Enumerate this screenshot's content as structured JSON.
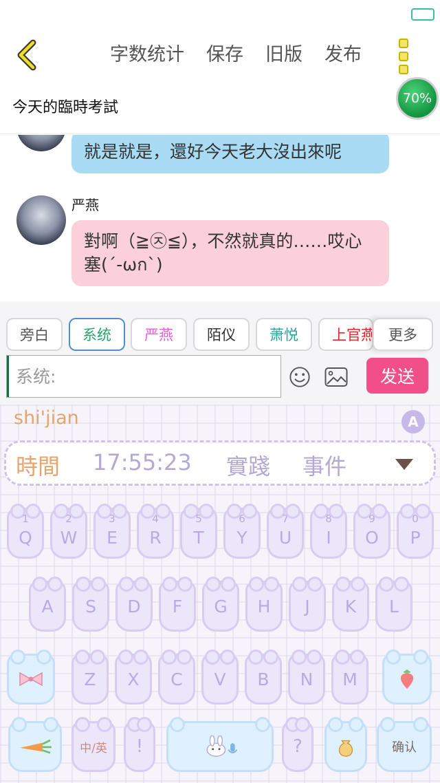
{
  "header": {
    "toolbar": [
      "字数统计",
      "保存",
      "旧版",
      "发布"
    ],
    "progress": "70%",
    "title": "今天的臨時考試"
  },
  "chat": {
    "messages": [
      {
        "text": "就是就是，還好今天老大沒出來呢"
      },
      {
        "sender": "严燕",
        "text": "對啊（≧㉨≦），不然就真的……哎心塞(´-ωก`)"
      }
    ]
  },
  "roles": [
    {
      "label": "旁白",
      "color": "#555555"
    },
    {
      "label": "系统",
      "color": "#25a56a",
      "active": true
    },
    {
      "label": "严燕",
      "color": "#e45fd6"
    },
    {
      "label": "陌仪",
      "color": "#333333"
    },
    {
      "label": "萧悦",
      "color": "#2aa49a"
    },
    {
      "label": "上官燕",
      "color": "#e1262d"
    }
  ],
  "more_label": "更多",
  "composer": {
    "placeholder": "系统:",
    "send_label": "发送"
  },
  "keyboard": {
    "pinyin": "shi'jian",
    "candidates": [
      "時間",
      "17:55:23",
      "實踐",
      "事件"
    ],
    "row1": [
      [
        "Q",
        "1"
      ],
      [
        "W",
        "2"
      ],
      [
        "E",
        "3"
      ],
      [
        "R",
        "4"
      ],
      [
        "T",
        "5"
      ],
      [
        "Y",
        "6"
      ],
      [
        "U",
        "7"
      ],
      [
        "I",
        "8"
      ],
      [
        "O",
        "9"
      ],
      [
        "P",
        "0"
      ]
    ],
    "row2": [
      "A",
      "S",
      "D",
      "F",
      "G",
      "H",
      "J",
      "K",
      "L"
    ],
    "row3": [
      "Z",
      "X",
      "C",
      "V",
      "B",
      "N",
      "M"
    ],
    "lang_label": "中/英",
    "confirm_label": "确认",
    "symbol_1": "!",
    "symbol_2": "?"
  }
}
